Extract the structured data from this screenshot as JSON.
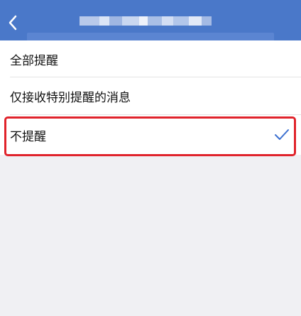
{
  "header": {
    "back_icon": "chevron-left-icon",
    "title_obscured": true,
    "background": "#4a78c9"
  },
  "options": [
    {
      "label": "全部提醒",
      "selected": false
    },
    {
      "label": "仅接收特别提醒的消息",
      "selected": false
    },
    {
      "label": "不提醒",
      "selected": true
    }
  ],
  "check_icon": "checkmark-icon",
  "colors": {
    "accent": "#3b6fd0",
    "highlight_border": "#e0232b",
    "background": "#f0f0f3"
  }
}
